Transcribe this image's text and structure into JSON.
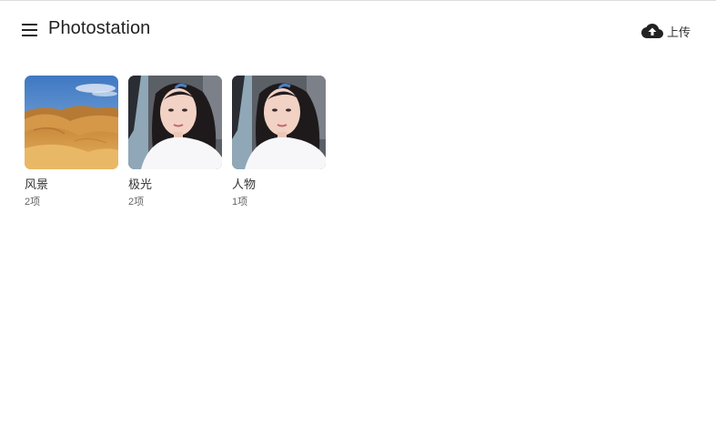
{
  "header": {
    "menu_icon": "menu-icon",
    "title": "Photostation",
    "upload_icon": "cloud-upload-icon",
    "upload_label": "上传"
  },
  "albums": [
    {
      "name": "风景",
      "count": "2项",
      "thumbnail": "desert-dunes-image"
    },
    {
      "name": "极光",
      "count": "2项",
      "thumbnail": "portrait-girl-image"
    },
    {
      "name": "人物",
      "count": "1项",
      "thumbnail": "portrait-girl-image"
    }
  ],
  "colors": {
    "background": "#ffffff",
    "title_text": "#222222",
    "secondary_text": "#666666"
  }
}
